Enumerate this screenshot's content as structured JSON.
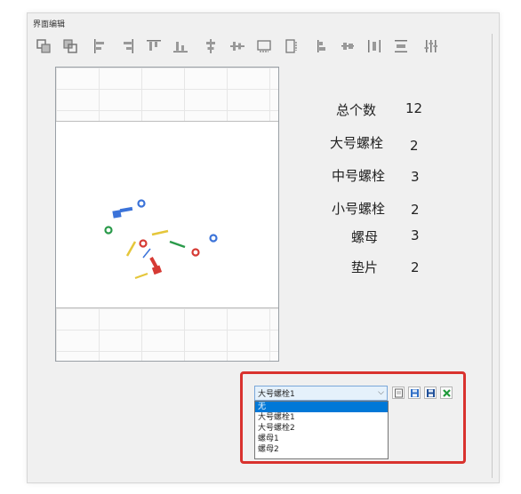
{
  "window": {
    "title": "界面编辑"
  },
  "toolbar": {
    "icons": [
      "bring-to-front-icon",
      "send-to-back-icon",
      "align-left-icon",
      "align-right-icon",
      "align-top-icon",
      "align-bottom-icon",
      "center-horizontal-icon",
      "center-vertical-icon",
      "same-width-icon",
      "same-height-icon",
      "distribute-top-icon",
      "distribute-middle-icon",
      "distribute-horizontal-icon",
      "distribute-vertical-icon",
      "spacing-settings-icon"
    ]
  },
  "stats": [
    {
      "label": "总个数",
      "value": "12"
    },
    {
      "label": "大号螺栓",
      "value": "2"
    },
    {
      "label": "中号螺栓",
      "value": "3"
    },
    {
      "label": "小号螺栓",
      "value": "2"
    },
    {
      "label": "螺母",
      "value": "3"
    },
    {
      "label": "垫片",
      "value": "2"
    }
  ],
  "selector": {
    "selected": "大号螺栓1",
    "options": [
      "无",
      "大号螺栓1",
      "大号螺栓2",
      "螺母1",
      "螺母2"
    ],
    "highlighted_option": "无"
  },
  "colors": {
    "accent": "#0078d7",
    "highlight_border": "#d9322e"
  }
}
